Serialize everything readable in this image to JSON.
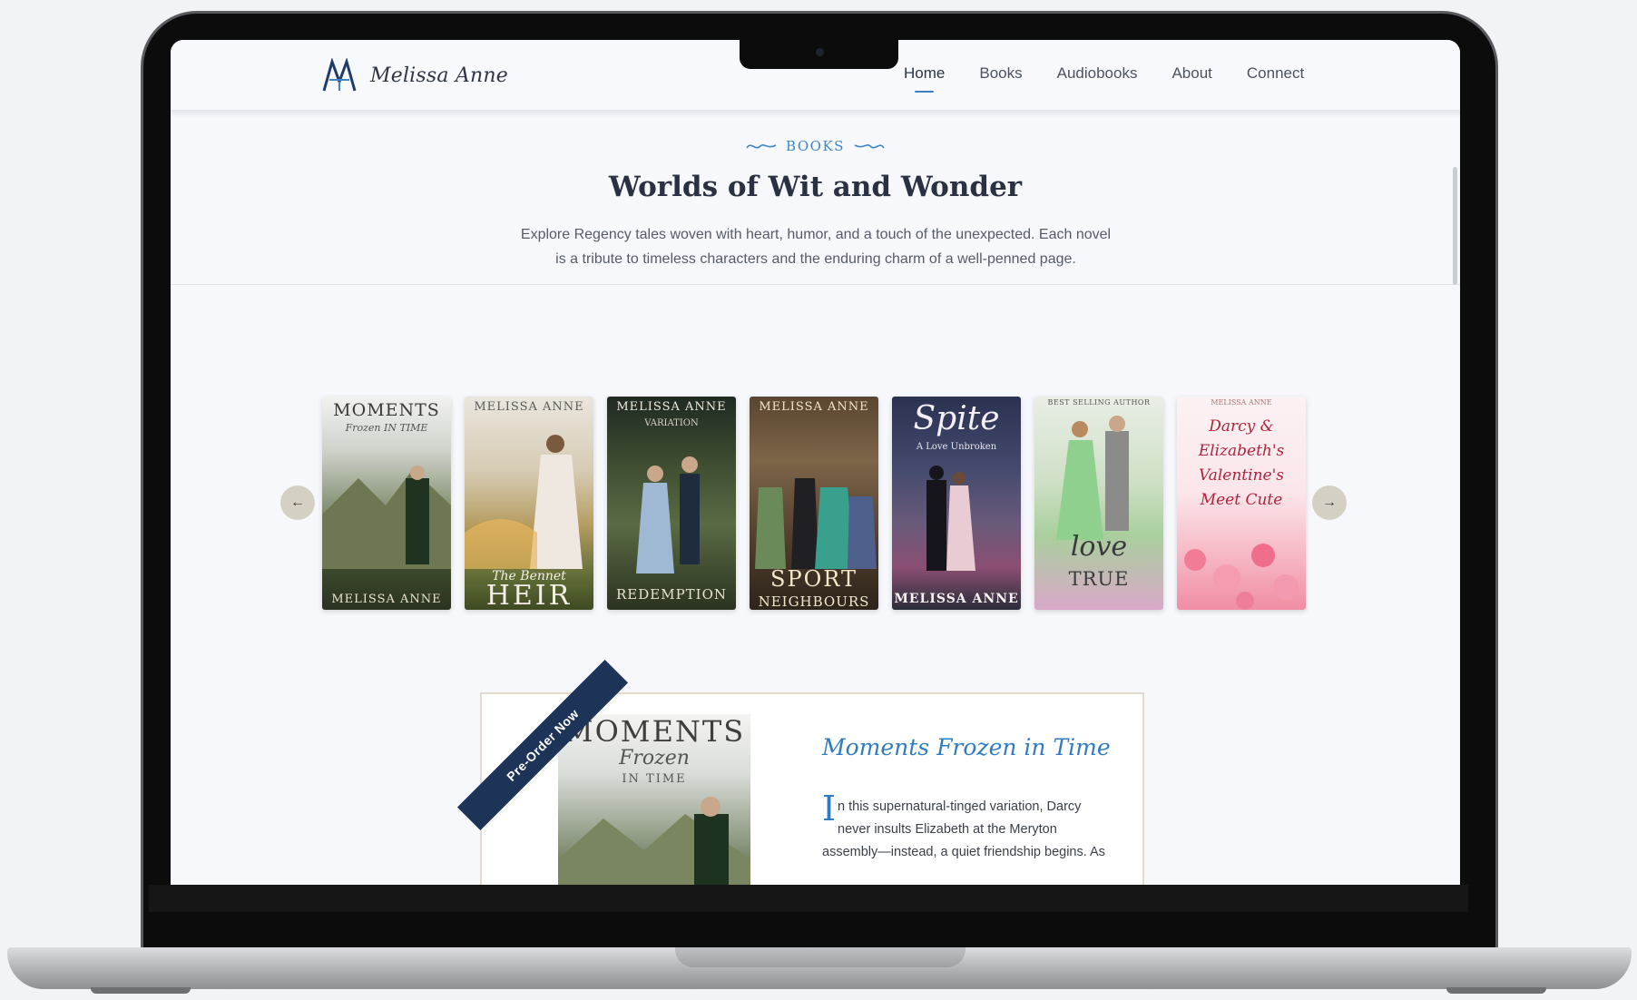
{
  "header": {
    "brand": "Melissa Anne",
    "nav": [
      "Home",
      "Books",
      "Audiobooks",
      "About",
      "Connect"
    ],
    "active": "Home"
  },
  "books_section": {
    "eyebrow": "BOOKS",
    "title": "Worlds of Wit and Wonder",
    "lede": "Explore Regency tales woven with heart, humor, and a touch of the unexpected. Each novel is a tribute to timeless characters and the enduring charm of a well-penned page."
  },
  "carousel": {
    "prev_icon": "arrow-left-icon",
    "next_icon": "arrow-right-icon",
    "covers": [
      {
        "top": "MOMENTS",
        "mid": "Frozen IN TIME",
        "bottom": "MELISSA ANNE"
      },
      {
        "top": "MELISSA ANNE",
        "mid": "The Bennet",
        "bottom": "HEIR"
      },
      {
        "top": "MELISSA ANNE",
        "mid": "VARIATION",
        "bottom": "REDEMPTION"
      },
      {
        "top": "MELISSA ANNE",
        "mid": "SPORT",
        "bottom": "NEIGHBOURS"
      },
      {
        "top": "Spite",
        "mid": "A Love Unbroken",
        "bottom": "MELISSA ANNE"
      },
      {
        "top": "BEST SELLING AUTHOR",
        "mid": "love",
        "bottom": "TRUE"
      },
      {
        "top": "MELISSA ANNE",
        "mid": "Darcy & Elizabeth's Valentine's Meet Cute",
        "bottom": ""
      }
    ]
  },
  "feature": {
    "ribbon": "Pre-Order Now",
    "cover_top": "MOMENTS",
    "cover_mid": "Frozen",
    "cover_sub": "IN TIME",
    "title": "Moments Frozen in Time",
    "dropcap": "I",
    "body": "n this supernatural-tinged variation, Darcy never insults Elizabeth at the Meryton assembly—instead, a quiet friendship begins. As"
  }
}
